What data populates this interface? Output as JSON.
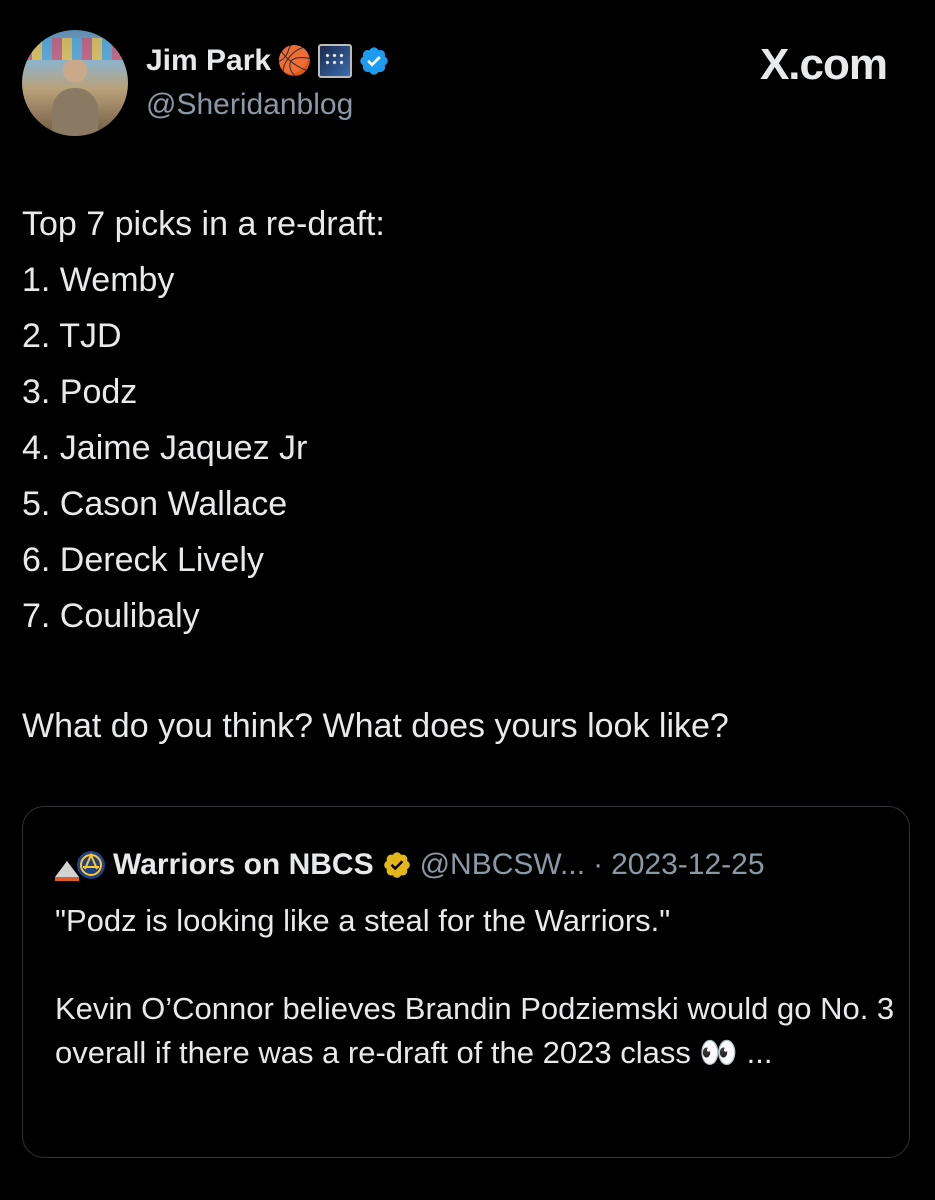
{
  "author": {
    "display_name": "Jim Park",
    "name_emojis": [
      "🏀"
    ],
    "handle": "@Sheridanblog",
    "verified": true,
    "verified_color": "#1d9bf0"
  },
  "brand": {
    "label": "X.com"
  },
  "tweet": {
    "intro": "Top 7 picks in a re-draft:",
    "picks": [
      "1. Wemby",
      "2. TJD",
      "3. Podz",
      "4. Jaime Jaquez Jr",
      "5. Cason Wallace",
      "6. Dereck Lively",
      "7. Coulibaly"
    ],
    "question": "What do you think? What does yours look like?"
  },
  "quoted_tweet": {
    "display_name": "Warriors on NBCS",
    "handle": "@NBCSW...",
    "separator": "·",
    "date": "2023-12-25",
    "badge_color": "#e2b719",
    "line1": "\"Podz is looking like a steal for the Warriors.\"",
    "line2": "Kevin O’Connor believes Brandin Podziemski would go No. 3 overall if there was a re-draft of the 2023 class 👀 ..."
  },
  "colors": {
    "background": "#000000",
    "text": "#e7e9ea",
    "muted": "#8b98a5",
    "border": "#2f3336"
  }
}
